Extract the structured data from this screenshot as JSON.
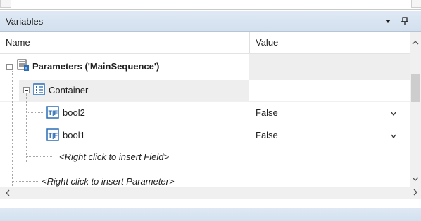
{
  "panel": {
    "title": "Variables",
    "menu_icon": "dropdown-arrow-icon",
    "pin_icon": "pin-icon"
  },
  "columns": {
    "name": "Name",
    "value": "Value"
  },
  "tree": {
    "parameters": {
      "label": "Parameters ('MainSequence')",
      "icon": "parameters-icon"
    },
    "container": {
      "label": "Container",
      "icon": "container-icon"
    },
    "fields": [
      {
        "label": "bool2",
        "value": "False",
        "icon": "boolean-field-icon"
      },
      {
        "label": "bool1",
        "value": "False",
        "icon": "boolean-field-icon"
      }
    ],
    "insert_field_hint": "<Right click to insert Field>",
    "insert_parameter_hint": "<Right click to insert Parameter>"
  },
  "colors": {
    "header_bg": "#d3e0ee",
    "selection_band": "#eeeeee",
    "icon_blue": "#2a6db7"
  }
}
